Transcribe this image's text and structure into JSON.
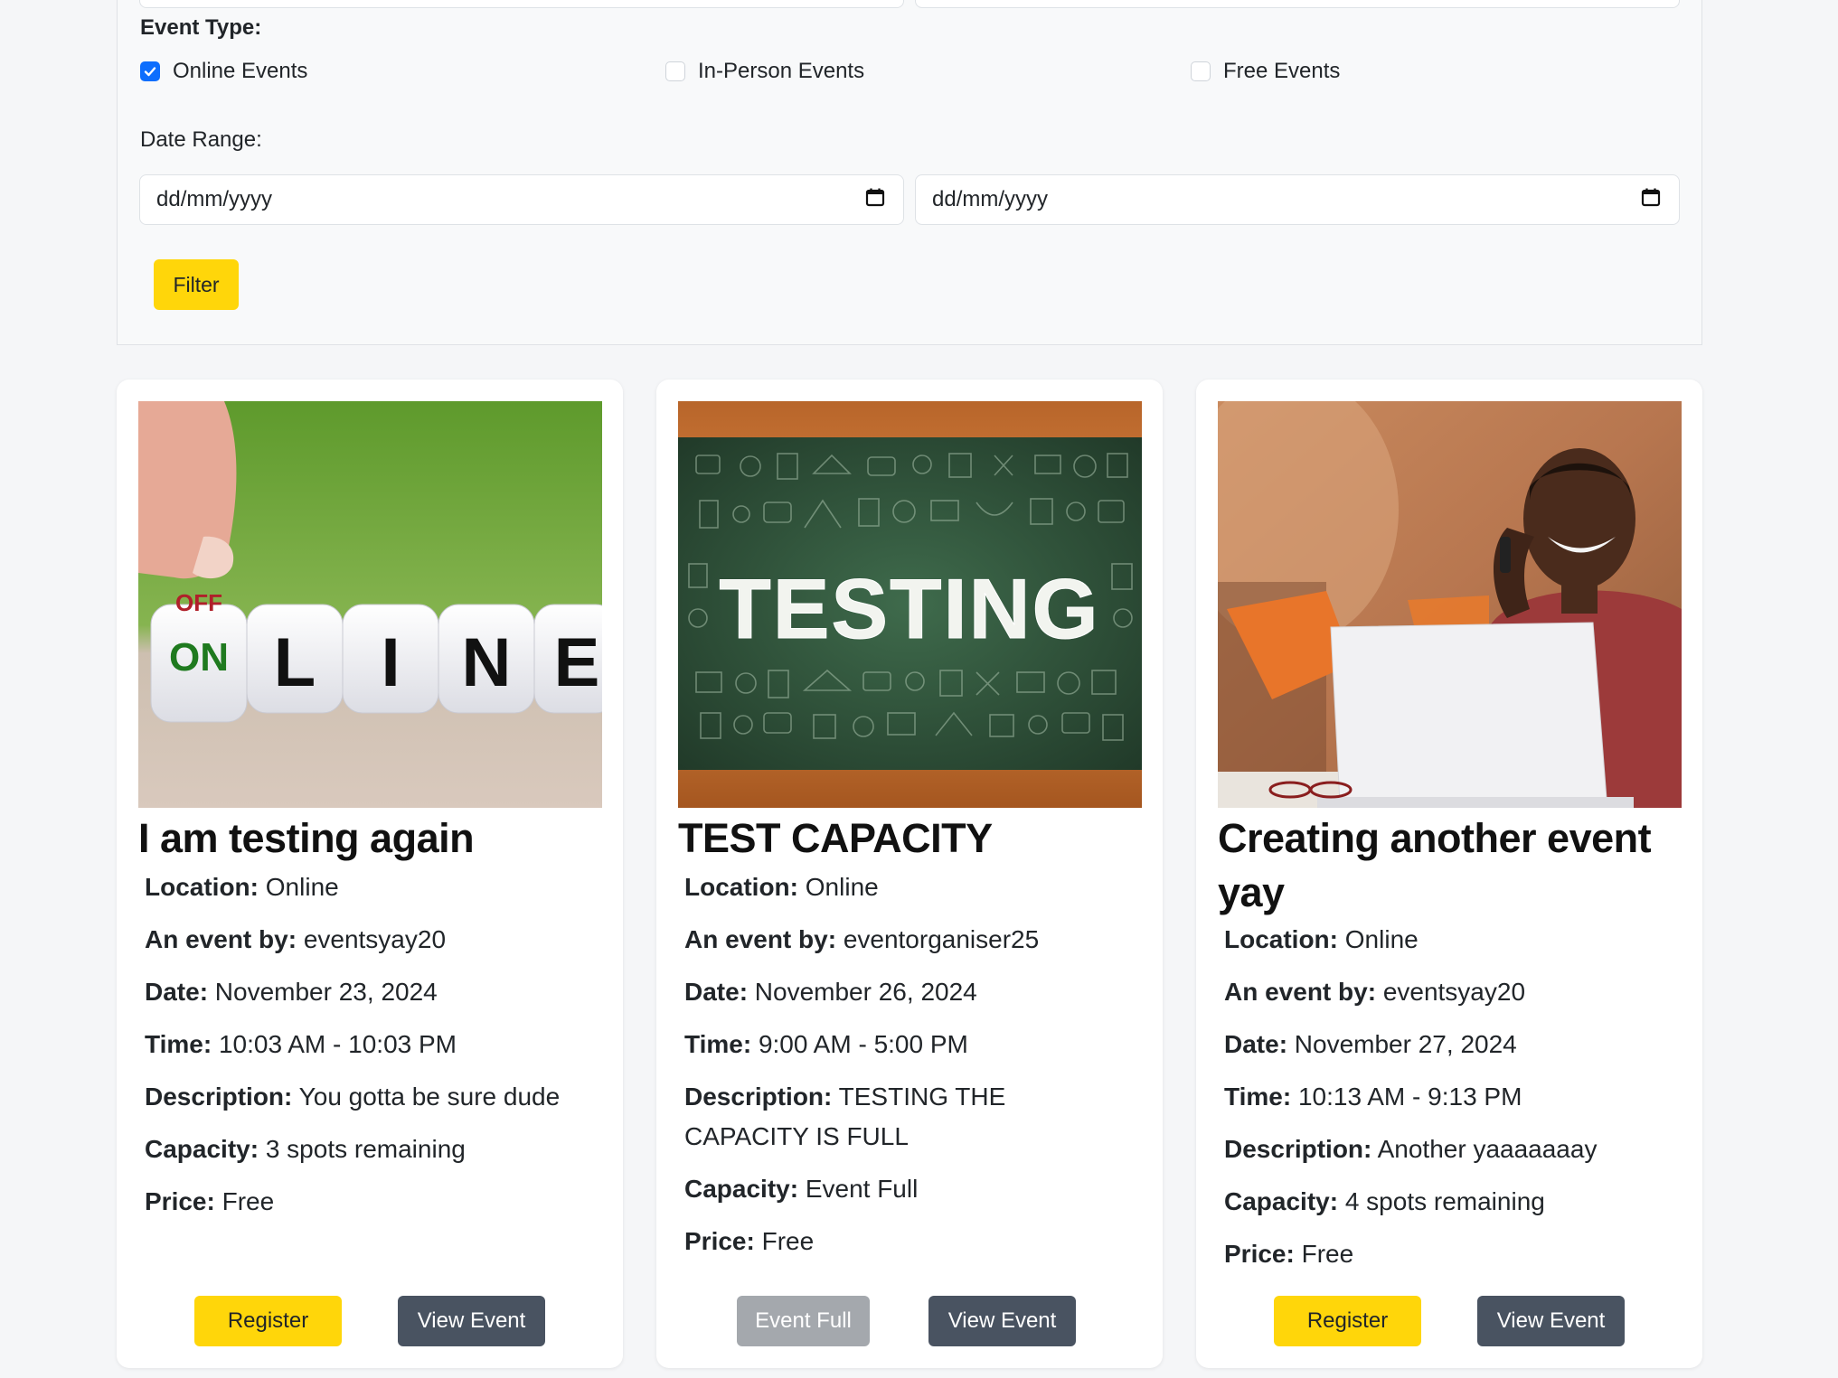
{
  "filters": {
    "event_type_label": "Event Type:",
    "options": [
      {
        "label": "Online Events",
        "checked": true
      },
      {
        "label": "In-Person Events",
        "checked": false
      },
      {
        "label": "Free Events",
        "checked": false
      }
    ],
    "date_range_label": "Date Range:",
    "date_from_placeholder": "dd/mm/yyyy",
    "date_to_placeholder": "dd/mm/yyyy",
    "filter_button": "Filter"
  },
  "events": [
    {
      "title": "I am testing again",
      "image": "online-dice-image",
      "image_text": {
        "off": "OFF",
        "on": "ON",
        "letters": [
          "L",
          "I",
          "N",
          "E"
        ]
      },
      "location_label": "Location:",
      "location": "Online",
      "organizer_label": "An event by:",
      "organizer": "eventsyay20",
      "date_label": "Date:",
      "date": "November 23, 2024",
      "time_label": "Time:",
      "time": "10:03 AM - 10:03 PM",
      "description_label": "Description:",
      "description": "You gotta be sure dude",
      "capacity_label": "Capacity:",
      "capacity": "3 spots remaining",
      "price_label": "Price:",
      "price": "Free",
      "primary_button": "Register",
      "primary_enabled": true,
      "view_button": "View Event"
    },
    {
      "title": "TEST CAPACITY",
      "image": "chalkboard-testing-image",
      "image_text": {
        "word": "TESTING"
      },
      "location_label": "Location:",
      "location": "Online",
      "organizer_label": "An event by:",
      "organizer": "eventorganiser25",
      "date_label": "Date:",
      "date": "November 26, 2024",
      "time_label": "Time:",
      "time": "9:00 AM - 5:00 PM",
      "description_label": "Description:",
      "description": "TESTING THE CAPACITY IS FULL",
      "capacity_label": "Capacity:",
      "capacity": "Event Full",
      "price_label": "Price:",
      "price": "Free",
      "primary_button": "Event Full",
      "primary_enabled": false,
      "view_button": "View Event"
    },
    {
      "title": "Creating another event yay",
      "image": "man-on-phone-laptop-image",
      "location_label": "Location:",
      "location": "Online",
      "organizer_label": "An event by:",
      "organizer": "eventsyay20",
      "date_label": "Date:",
      "date": "November 27, 2024",
      "time_label": "Time:",
      "time": "10:13 AM - 9:13 PM",
      "description_label": "Description:",
      "description": "Another yaaaaaaay",
      "capacity_label": "Capacity:",
      "capacity": "4 spots remaining",
      "price_label": "Price:",
      "price": "Free",
      "primary_button": "Register",
      "primary_enabled": true,
      "view_button": "View Event"
    }
  ],
  "colors": {
    "accent": "#ffd60a",
    "dark_button": "#495361",
    "disabled_button": "#a4a8ad",
    "checkbox": "#0d6efd"
  }
}
